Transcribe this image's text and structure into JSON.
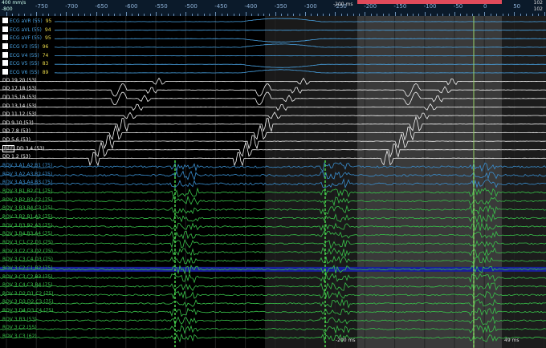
{
  "header": {
    "speed_line1": "400 mm/s",
    "speed_line2": "-800",
    "ms_label": "-200 ms",
    "right_line1": "102",
    "right_line2": "102"
  },
  "ruler_ticks": [
    "-750",
    "-700",
    "-650",
    "-600",
    "-550",
    "-500",
    "-450",
    "-400",
    "-350",
    "-300",
    "-250",
    "-200",
    "-150",
    "-100",
    "-50",
    "0",
    "50"
  ],
  "channels": [
    {
      "name": "ECG aVR (55)",
      "value": "95",
      "color": "#4aa6e8",
      "kind": "ecg",
      "checked": true
    },
    {
      "name": "ECG aVL (55)",
      "value": "94",
      "color": "#4aa6e8",
      "kind": "ecg",
      "checked": true
    },
    {
      "name": "ECG aVF (55)",
      "value": "95",
      "color": "#4aa6e8",
      "kind": "ecg",
      "checked": true
    },
    {
      "name": "ECG V3 (55)",
      "value": "96",
      "color": "#4aa6e8",
      "kind": "ecg",
      "checked": true
    },
    {
      "name": "ECG V4 (55)",
      "value": "74",
      "color": "#4aa6e8",
      "kind": "ecg",
      "checked": true
    },
    {
      "name": "ECG V5 (55)",
      "value": "83",
      "color": "#4aa6e8",
      "kind": "ecg",
      "checked": true
    },
    {
      "name": "ECG V6 (55)",
      "value": "89",
      "color": "#4aa6e8",
      "kind": "ecg",
      "checked": true
    },
    {
      "name": "DD 19,20 (53)",
      "color": "#f2f2f2",
      "kind": "dd"
    },
    {
      "name": "DD 17,18 (53)",
      "color": "#f2f2f2",
      "kind": "dd"
    },
    {
      "name": "DD 15,16 (53)",
      "color": "#f2f2f2",
      "kind": "dd"
    },
    {
      "name": "DD 13,14 (53)",
      "color": "#f2f2f2",
      "kind": "dd"
    },
    {
      "name": "DD 11,12 (53)",
      "color": "#f2f2f2",
      "kind": "dd"
    },
    {
      "name": "DD 9,10 (53)",
      "color": "#f2f2f2",
      "kind": "dd"
    },
    {
      "name": "DD 7,8 (53)",
      "color": "#f2f2f2",
      "kind": "dd"
    },
    {
      "name": "DD 5,6 (53)",
      "color": "#f2f2f2",
      "kind": "dd"
    },
    {
      "name": "DD 3,4 (53)",
      "color": "#f2f2f2",
      "kind": "dd",
      "ref": "REF"
    },
    {
      "name": "DD 1,2 (53)",
      "color": "#f2f2f2",
      "kind": "dd"
    },
    {
      "name": "ROV 3   A1,A2,B1 (75)",
      "color": "#3a8fd0",
      "kind": "rovb"
    },
    {
      "name": "ROV 3   A2,A3,B2 (75)",
      "color": "#3a8fd0",
      "kind": "rovb"
    },
    {
      "name": "ROV 3   A3,A4,B3 (75)",
      "color": "#3a8fd0",
      "kind": "rovb"
    },
    {
      "name": "ROV 3   B1,B2,C1 (75)",
      "color": "#39c24a",
      "kind": "rov"
    },
    {
      "name": "ROV 3   B2,B3,C2 (75)",
      "color": "#39c24a",
      "kind": "rov"
    },
    {
      "name": "ROV 3   B3,B4,C3 (75)",
      "color": "#39c24a",
      "kind": "rov"
    },
    {
      "name": "ROV 3   B2,B1,A2 (75)",
      "color": "#39c24a",
      "kind": "rov"
    },
    {
      "name": "ROV 3   B3,B2,A3 (75)",
      "color": "#39c24a",
      "kind": "rov"
    },
    {
      "name": "ROV 3   B4,B3,A4 (75)",
      "color": "#39c24a",
      "kind": "rov"
    },
    {
      "name": "ROV 3   C1,C2,D1 (75)",
      "color": "#39c24a",
      "kind": "rov"
    },
    {
      "name": "ROV 3   C2,C3,D2 (75)",
      "color": "#39c24a",
      "kind": "rov"
    },
    {
      "name": "ROV 3   C3,C4,D3 (75)",
      "color": "#39c24a",
      "kind": "rov"
    },
    {
      "name": "ROV 3   C2,C1,B2 (75)",
      "color": "#39c24a",
      "kind": "rov",
      "highlight": true
    },
    {
      "name": "ROV 3   C3,C2,B3 (75)",
      "color": "#39c24a",
      "kind": "rov"
    },
    {
      "name": "ROV 3   C4,C3,B4 (75)",
      "color": "#39c24a",
      "kind": "rov"
    },
    {
      "name": "ROV 3   D2,D1,C2 (75)",
      "color": "#39c24a",
      "kind": "rov"
    },
    {
      "name": "ROV 3   D3,D2,C3 (75)",
      "color": "#39c24a",
      "kind": "rov"
    },
    {
      "name": "ROV 3   D4,D3,C4 (75)",
      "color": "#39c24a",
      "kind": "rov"
    },
    {
      "name": "ROV 3   B3 (53)",
      "color": "#39c24a",
      "kind": "rov"
    },
    {
      "name": "ROV 3   C2 (55)",
      "color": "#39c24a",
      "kind": "rov"
    },
    {
      "name": "ROV 3   C3 (62)",
      "color": "#39c24a",
      "kind": "rov"
    }
  ],
  "bottom": {
    "ms_left": "-200 ms",
    "ms_right": "49 ms"
  }
}
